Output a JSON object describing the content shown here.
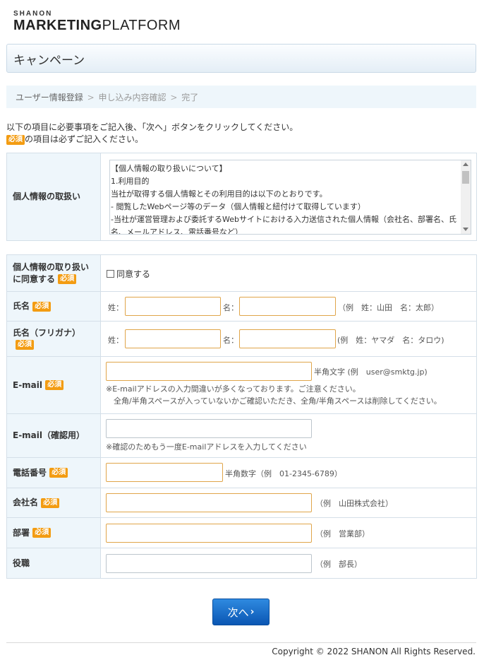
{
  "logo": {
    "small": "SHANON",
    "big_bold": "MARKETING",
    "big_light": "PLATFORM"
  },
  "page_title": "キャンペーン",
  "steps": {
    "step1": "ユーザー情報登録",
    "step2": "申し込み内容確認",
    "step3": "完了",
    "separator": ">"
  },
  "intro": {
    "line1": "以下の項目に必要事項をご記入後、「次へ」ボタンをクリックしてください。",
    "line2_suffix": "の項目は必ずご記入ください。"
  },
  "required_badge": "必須",
  "privacy": {
    "label": "個人情報の取扱い",
    "lines": [
      "【個人情報の取り扱いについて】",
      "1.利用目的",
      "当社が取得する個人情報とその利用目的は以下のとおりです。",
      "- 閲覧したWebページ等のデータ（個人情報と紐付けて取得しています）",
      "-当社が運営管理および委託するWebサイトにおける入力送信された個人情報（会社名、部署名、氏",
      "名、メールアドレス、電話番号など）"
    ]
  },
  "consent": {
    "label_line1": "個人情報の取り扱い",
    "label_line2": "に同意する",
    "checkbox_label": "同意する"
  },
  "name": {
    "label": "氏名",
    "sei": "姓：",
    "mei": "名：",
    "example": "（例　姓：山田　名：太郎）"
  },
  "furigana": {
    "label": "氏名（フリガナ）",
    "sei": "姓：",
    "mei": "名：",
    "example": "(例　姓：ヤマダ　名：タロウ)"
  },
  "email": {
    "label": "E-mail",
    "hint": "半角文字 (例　user@smktg.jp)",
    "note1": "※E-mailアドレスの入力間違いが多くなっております。ご注意ください。",
    "note2": "全角/半角スペースが入っていないかご確認いただき、全角/半角スペースは削除してください。"
  },
  "email_confirm": {
    "label": "E-mail（確認用）",
    "note": "※確認のためもう一度E-mailアドレスを入力してください"
  },
  "phone": {
    "label": "電話番号",
    "hint": "半角数字（例　01-2345-6789）"
  },
  "company": {
    "label": "会社名",
    "hint": "（例　山田株式会社）"
  },
  "department": {
    "label": "部署",
    "hint": "（例　営業部）"
  },
  "position": {
    "label": "役職",
    "hint": "（例　部長）"
  },
  "next_button": {
    "label": "次へ",
    "chevron": "›"
  },
  "footer": {
    "copyright": "Copyright © 2022 SHANON All Rights Reserved."
  },
  "colors": {
    "badge": "#f39c12",
    "label_bg": "#eef6fb",
    "button": "#0b56b3",
    "input_required_border": "#e0a54a"
  }
}
